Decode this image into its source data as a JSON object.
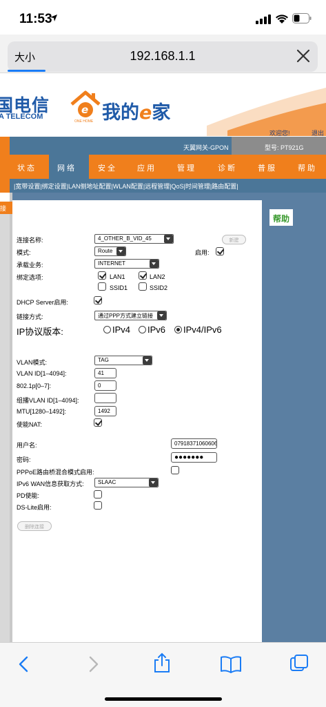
{
  "status": {
    "time": "11:53"
  },
  "browser": {
    "text_size_label": "大小",
    "url": "192.168.1.1"
  },
  "header": {
    "brand_cn": "国电信",
    "brand_en": "A TELECOM",
    "home_logo_small": "ONE HOME",
    "home_logo_prefix": "我的",
    "home_logo_e": "e",
    "home_logo_suffix": "家",
    "welcome": "欢迎您!",
    "logout": "退出",
    "gateway": "天翼网关-GPON",
    "model": "型号: PT921G"
  },
  "menu": [
    "状态",
    "网络",
    "安全",
    "应用",
    "管理",
    "诊断",
    "帮助"
  ],
  "menu_extra": "普服",
  "submenu": "|宽带设置|绑定设置|LAN侧地址配置|WLAN配置|远程管理|QoS|时间管理|路由配置|",
  "left_tab": "接",
  "help_label": "帮助",
  "form": {
    "conn_name_label": "连接名称:",
    "conn_name_value": "4_OTHER_B_VID_45",
    "new_button": "新建",
    "mode_label": "模式:",
    "mode_value": "Route",
    "enable_label": "启用:",
    "service_label": "承载业务:",
    "service_value": "INTERNET",
    "bind_label": "绑定选项:",
    "lan1": "LAN1",
    "lan2": "LAN2",
    "ssid1": "SSID1",
    "ssid2": "SSID2",
    "dhcp_label": "DHCP Server启用:",
    "link_label": "链接方式:",
    "link_value": "通过PPP方式建立链接",
    "ip_version_label": "IP协议版本:",
    "ipv4": "IPv4",
    "ipv6": "IPv6",
    "ipv4v6": "IPv4/IPv6",
    "vlan_mode_label": "VLAN模式:",
    "vlan_mode_value": "TAG",
    "vlan_id_label": "VLAN ID[1–4094]:",
    "vlan_id_value": "41",
    "p8021_label": "802.1p[0–7]:",
    "p8021_value": "0",
    "mcast_vlan_label": "组播VLAN ID[1–4094]:",
    "mcast_vlan_value": "",
    "mtu_label": "MTU[1280–1492]:",
    "mtu_value": "1492",
    "nat_label": "使能NAT:",
    "user_label": "用户名:",
    "user_value": "07918371060606",
    "pwd_label": "密码:",
    "pwd_value": "●●●●●●●",
    "pppoe_label": "PPPoE路由桥混合模式启用:",
    "ipv6wan_label": "IPv6 WAN信息获取方式:",
    "ipv6wan_value": "SLAAC",
    "pd_label": "PD使能:",
    "dslite_label": "DS-Lite启用:",
    "delete_button": "删除连接"
  }
}
